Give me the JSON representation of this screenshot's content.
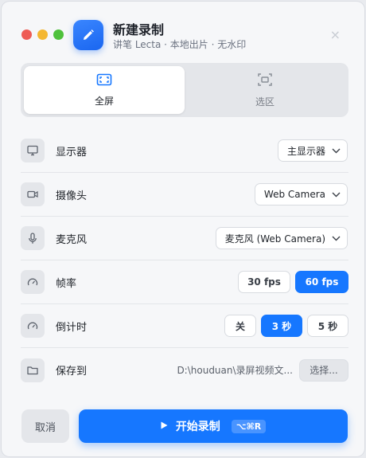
{
  "window": {
    "title": "新建录制",
    "subtitle": "讲笔 Lecta · 本地出片 · 无水印",
    "close_glyph": "×"
  },
  "modes": [
    {
      "label": "全屏",
      "icon": "fullscreen-icon",
      "active": true
    },
    {
      "label": "选区",
      "icon": "region-icon",
      "active": false
    }
  ],
  "settings": {
    "display": {
      "label": "显示器",
      "value": "主显示器",
      "icon": "monitor-icon"
    },
    "camera": {
      "label": "摄像头",
      "value": "Web Camera",
      "icon": "camera-icon"
    },
    "microphone": {
      "label": "麦克风",
      "value": "麦克风 (Web Camera)",
      "icon": "microphone-icon"
    },
    "framerate": {
      "label": "帧率",
      "options": [
        "30 fps",
        "60 fps"
      ],
      "selected": "60 fps",
      "icon": "gauge-icon"
    },
    "countdown": {
      "label": "倒计时",
      "options": [
        "关",
        "3 秒",
        "5 秒"
      ],
      "selected": "3 秒",
      "icon": "gauge-icon"
    },
    "save_to": {
      "label": "保存到",
      "path": "D:\\houduan\\录屏视频文...",
      "button": "选择...",
      "icon": "folder-icon"
    }
  },
  "footer": {
    "cancel_label": "取消",
    "start_label": "开始录制",
    "shortcut": "⌥⌘R"
  },
  "colors": {
    "accent": "#1677ff",
    "close": "#ee5c55",
    "minimize": "#f4b731",
    "maximize": "#4fc13c"
  }
}
